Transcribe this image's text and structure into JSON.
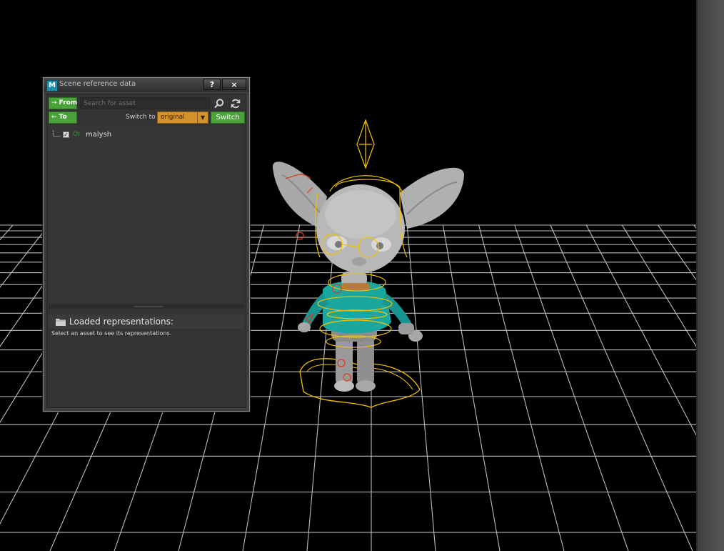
{
  "window": {
    "title": "Scene reference data",
    "help_label": "?",
    "close_label": "×"
  },
  "toolbar": {
    "from_label": "From",
    "to_label": "To",
    "search_placeholder": "Search for asset",
    "switch_to_label": "Switch to",
    "switch_value": "original",
    "switch_button": "Switch"
  },
  "tree": {
    "items": [
      {
        "prefix": "Or",
        "name": "malysh",
        "checked": true
      }
    ]
  },
  "representations": {
    "title": "Loaded representations:",
    "hint": "Select an asset to see its representations."
  },
  "colors": {
    "accent_green": "#4aa33a",
    "accent_orange": "#d4922a",
    "rig_yellow": "#f2c200",
    "rig_red": "#e03a1a",
    "shirt_teal": "#1aa7a0"
  }
}
